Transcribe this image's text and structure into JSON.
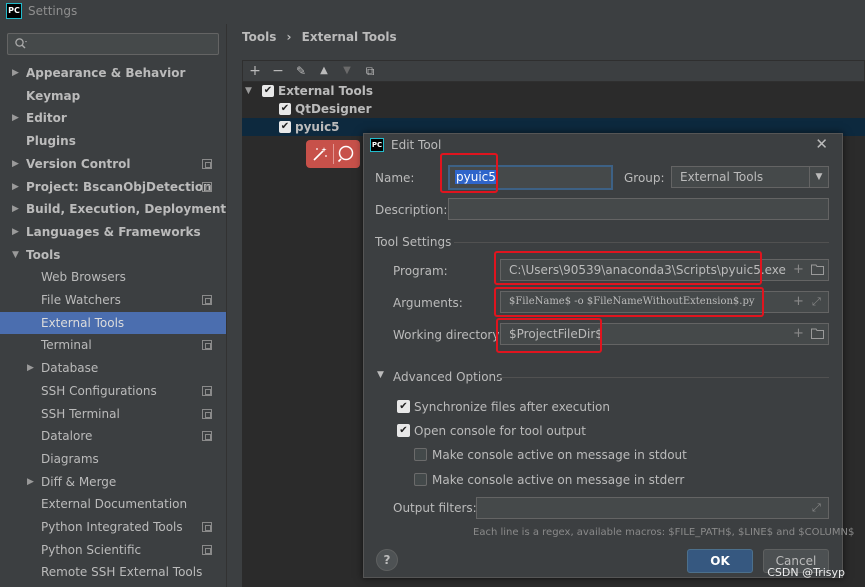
{
  "window": {
    "title": "Settings",
    "app_icon_text": "PC"
  },
  "search": {
    "placeholder": ""
  },
  "sidebar": {
    "items": [
      {
        "label": "Appearance & Behavior",
        "bold": true,
        "arrow": "▶"
      },
      {
        "label": "Keymap",
        "bold": true
      },
      {
        "label": "Editor",
        "bold": true,
        "arrow": "▶"
      },
      {
        "label": "Plugins",
        "bold": true
      },
      {
        "label": "Version Control",
        "bold": true,
        "arrow": "▶",
        "project": true
      },
      {
        "label": "Project: BscanObjDetection",
        "bold": true,
        "arrow": "▶",
        "project": true
      },
      {
        "label": "Build, Execution, Deployment",
        "bold": true,
        "arrow": "▶"
      },
      {
        "label": "Languages & Frameworks",
        "bold": true,
        "arrow": "▶"
      },
      {
        "label": "Tools",
        "bold": true,
        "arrow": "▼"
      },
      {
        "label": "Web Browsers"
      },
      {
        "label": "File Watchers",
        "project": true
      },
      {
        "label": "External Tools",
        "selected": true
      },
      {
        "label": "Terminal",
        "project": true
      },
      {
        "label": "Database",
        "arrow": "▶"
      },
      {
        "label": "SSH Configurations",
        "project": true
      },
      {
        "label": "SSH Terminal",
        "project": true
      },
      {
        "label": "Datalore",
        "project": true
      },
      {
        "label": "Diagrams"
      },
      {
        "label": "Diff & Merge",
        "arrow": "▶"
      },
      {
        "label": "External Documentation"
      },
      {
        "label": "Python Integrated Tools",
        "project": true
      },
      {
        "label": "Python Scientific",
        "project": true
      },
      {
        "label": "Remote SSH External Tools"
      }
    ]
  },
  "breadcrumb": {
    "part1": "Tools",
    "separator": "›",
    "part2": "External Tools"
  },
  "toolbar": {
    "add": "+",
    "remove": "−",
    "edit": "✎",
    "up": "▲",
    "down": "▼",
    "copy": "⧉"
  },
  "ext_tree": {
    "group_label": "External Tools",
    "tools": [
      "QtDesigner",
      "pyuic5"
    ]
  },
  "dialog": {
    "title": "Edit Tool",
    "name_label": "Name:",
    "name_value": "pyuic5",
    "group_label": "Group:",
    "group_value": "External Tools",
    "description_label": "Description:",
    "description_value": "",
    "tool_settings_label": "Tool Settings",
    "program_label": "Program:",
    "program_value": "C:\\Users\\90539\\anaconda3\\Scripts\\pyuic5.exe",
    "arguments_label": "Arguments:",
    "arguments_value": "$FileName$ -o $FileNameWithoutExtension$.py",
    "workdir_label": "Working directory:",
    "workdir_value": "$ProjectFileDir$",
    "advanced_label": "Advanced Options",
    "options": [
      {
        "label": "Synchronize files after execution",
        "checked": true
      },
      {
        "label": "Open console for tool output",
        "checked": true
      },
      {
        "label": "Make console active on message in stdout",
        "checked": false
      },
      {
        "label": "Make console active on message in stderr",
        "checked": false
      }
    ],
    "output_filters_label": "Output filters:",
    "output_filters_value": "",
    "hint": "Each line is a regex, available macros: $FILE_PATH$, $LINE$ and $COLUMN$",
    "help_label": "?",
    "ok_label": "OK",
    "cancel_label": "Cancel"
  },
  "watermark": "CSDN @Trisyp",
  "colors": {
    "selection": "#4b6eaf",
    "ok_button": "#365880",
    "annotation": "#e0141e",
    "floating_toolbar": "#c7514a"
  }
}
